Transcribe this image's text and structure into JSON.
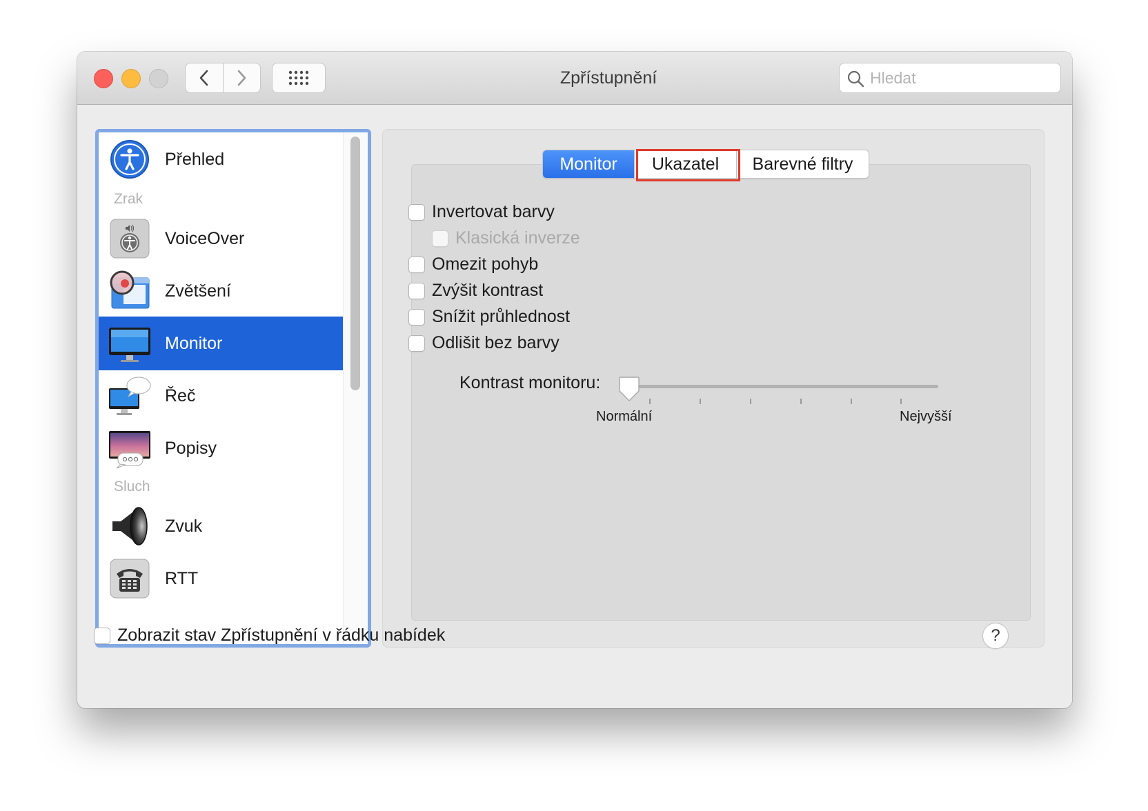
{
  "window": {
    "title": "Zpřístupnění"
  },
  "toolbar": {
    "back_icon": "chevron-left-icon",
    "forward_icon": "chevron-right-icon",
    "grid_icon": "grid-icon"
  },
  "search": {
    "placeholder": "Hledat",
    "value": ""
  },
  "sidebar": {
    "items": [
      {
        "label": "Přehled",
        "icon": "accessibility-icon"
      },
      {
        "section": "Zrak"
      },
      {
        "label": "VoiceOver",
        "icon": "voiceover-icon"
      },
      {
        "label": "Zvětšení",
        "icon": "magnifier-icon"
      },
      {
        "label": "Monitor",
        "icon": "monitor-icon",
        "selected": true
      },
      {
        "label": "Řeč",
        "icon": "speech-icon"
      },
      {
        "label": "Popisy",
        "icon": "captions-icon"
      },
      {
        "section": "Sluch"
      },
      {
        "label": "Zvuk",
        "icon": "speaker-icon"
      },
      {
        "label": "RTT",
        "icon": "telephone-icon"
      }
    ]
  },
  "tabs": [
    {
      "label": "Monitor",
      "selected": true
    },
    {
      "label": "Ukazatel",
      "highlighted": true
    },
    {
      "label": "Barevné filtry"
    }
  ],
  "options": [
    {
      "label": "Invertovat barvy",
      "checked": false
    },
    {
      "label": "Klasická inverze",
      "checked": false,
      "disabled": true
    },
    {
      "label": "Omezit pohyb",
      "checked": false
    },
    {
      "label": "Zvýšit kontrast",
      "checked": false
    },
    {
      "label": "Snížit průhlednost",
      "checked": false
    },
    {
      "label": "Odlišit bez barvy",
      "checked": false
    }
  ],
  "contrast_slider": {
    "label": "Kontrast monitoru:",
    "min_label": "Normální",
    "max_label": "Nejvyšší",
    "value": 0
  },
  "footer": {
    "menu_status_label": "Zobrazit stav Zpřístupnění v řádku nabídek",
    "menu_status_checked": false,
    "help_label": "?"
  },
  "colors": {
    "accent": "#1f63d8",
    "highlight_box": "#e0392b",
    "close": "#fc605b",
    "minimize": "#fdbc40"
  }
}
